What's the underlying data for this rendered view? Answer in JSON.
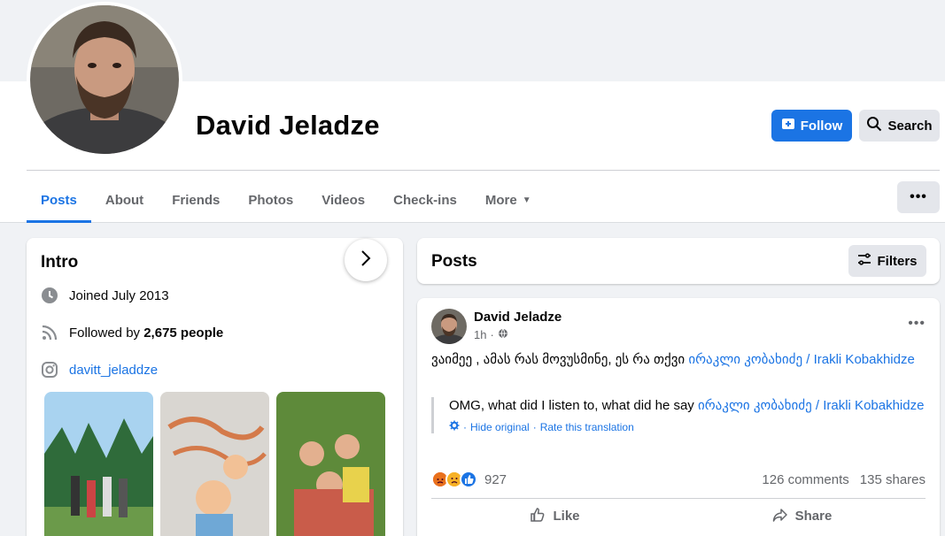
{
  "profile": {
    "name": "David Jeladze",
    "follow_label": "Follow",
    "search_label": "Search"
  },
  "tabs": [
    {
      "label": "Posts",
      "active": true
    },
    {
      "label": "About"
    },
    {
      "label": "Friends"
    },
    {
      "label": "Photos"
    },
    {
      "label": "Videos"
    },
    {
      "label": "Check-ins"
    },
    {
      "label": "More"
    }
  ],
  "intro": {
    "title": "Intro",
    "joined": "Joined July 2013",
    "followed_prefix": "Followed by ",
    "followed_count": "2,675 people",
    "instagram": "davitt_jeladdze"
  },
  "posts_section": {
    "title": "Posts",
    "filters_label": "Filters"
  },
  "post": {
    "author": "David Jeladze",
    "time": "1h",
    "text": "ვაიმეე , ამას რას მოვუსმინე, ეს რა თქვი ",
    "mention": "ირაკლი კობახიძე / Irakli Kobakhidze",
    "translation_text": "OMG, what did I listen to, what did he say ",
    "translation_mention": "ირაკლი კობახიძე / Irakli Kobakhidze",
    "hide_original": "Hide original",
    "separator": "·",
    "rate_translation": "Rate this translation",
    "reactions_count": "927",
    "comments": "126 comments",
    "shares": "135 shares",
    "like_label": "Like",
    "share_label": "Share"
  },
  "colors": {
    "accent": "#1b74e4",
    "background": "#f0f2f5",
    "secondary_text": "#65676b"
  }
}
